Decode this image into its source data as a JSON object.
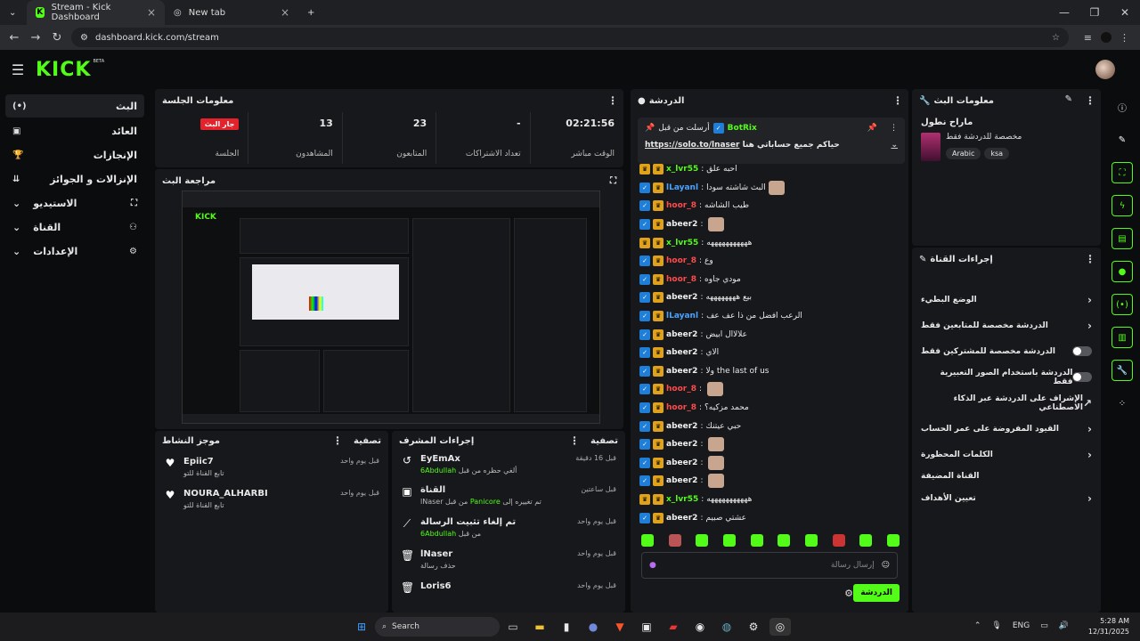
{
  "browser": {
    "tabs": [
      {
        "label": "Stream - Kick Dashboard"
      },
      {
        "label": "New tab"
      }
    ],
    "url": "dashboard.kick.com/stream"
  },
  "app": {
    "logo": "KICK",
    "beta": "BETA"
  },
  "sidebar": {
    "items": [
      {
        "label": "البث",
        "icon": "(•)"
      },
      {
        "label": "العائد",
        "icon": "▣"
      },
      {
        "label": "الإنجازات",
        "icon": "🏆"
      },
      {
        "label": "الإنزالات و الجوائز",
        "icon": "⇊"
      },
      {
        "label": "الاستيديو",
        "icon": "⛶"
      },
      {
        "label": "القناة",
        "icon": "⚇"
      },
      {
        "label": "الإعدادات",
        "icon": "⚙"
      }
    ]
  },
  "session": {
    "title": "معلومات الجلسة",
    "badge": "جار البث",
    "stats": [
      {
        "value": "02:21:56",
        "label": "الوقت مباشر"
      },
      {
        "value": "-",
        "label": "تعداد الاشتراكات"
      },
      {
        "value": "23",
        "label": "المتابعون"
      },
      {
        "value": "13",
        "label": "المشاهدون"
      },
      {
        "label": "الجلسة"
      }
    ]
  },
  "preview": {
    "title": "مراجعة البث"
  },
  "activity": {
    "title": "موجز النشاط",
    "filter": "تصفية",
    "items": [
      {
        "name": "Epiic7",
        "sub": "تابع القناة للتو",
        "time": "قبل يوم واحد"
      },
      {
        "name": "NOURA_ALHARBI",
        "sub": "تابع القناة للتو",
        "time": "قبل يوم واحد"
      }
    ]
  },
  "modactions": {
    "title": "إجراءات المشرف",
    "filter": "تصفية",
    "items": [
      {
        "name": "EyEmAx",
        "sub": "ألغي حظره من قبل",
        "actor": "6Abdullah",
        "time": "قبل 16 دقيقة",
        "icon": "↺"
      },
      {
        "name": "القناة",
        "sub": "تم تغييره إلى",
        "actor": "Panicore",
        "sub2": "من قبل",
        "actor2": "lNaser",
        "time": "قبل ساعتين",
        "icon": "▣"
      },
      {
        "name": "تم إلغاء تثبيت الرسالة",
        "sub": "من قبل",
        "actor": "6Abdullah",
        "time": "قبل يوم واحد",
        "icon": "⟋"
      },
      {
        "name": "lNaser",
        "sub": "حذف رسالة",
        "time": "قبل يوم واحد",
        "icon": "🗑"
      },
      {
        "name": "Loris6",
        "sub": "",
        "time": "قبل يوم واحد",
        "icon": "🗑"
      }
    ]
  },
  "chat": {
    "title": "الدردشة",
    "pinned": {
      "label": "أرسلت من قبل",
      "user": "BotRix",
      "text": "حياكم جميع حساباتي هنا",
      "link": "https://solo.to/lnaser"
    },
    "messages": [
      {
        "user": "x_lvr55",
        "color": "#53fc18",
        "badge": "b2",
        "text": "احبه علق"
      },
      {
        "user": "lLayanl",
        "color": "#4aa3ff",
        "badge": "b1",
        "text": "البث شاشته سودا",
        "emote": true
      },
      {
        "user": "hoor_8",
        "color": "#ff4a4a",
        "badge": "b1",
        "text": "طيب الشاشه"
      },
      {
        "user": "abeer2",
        "color": "#f0f0f0",
        "badge": "b1",
        "text": "",
        "emote": true
      },
      {
        "user": "x_lvr55",
        "color": "#53fc18",
        "badge": "b2",
        "text": "هههههههههههه"
      },
      {
        "user": "hoor_8",
        "color": "#ff4a4a",
        "badge": "b1",
        "text": "وع"
      },
      {
        "user": "hoor_8",
        "color": "#ff4a4a",
        "badge": "b1",
        "text": "مودي جاوه"
      },
      {
        "user": "abeer2",
        "color": "#f0f0f0",
        "badge": "b1",
        "text": "بيع ههههههههه"
      },
      {
        "user": "lLayanl",
        "color": "#4aa3ff",
        "badge": "b1",
        "text": "الرعب افضل من ذا عف عف"
      },
      {
        "user": "abeer2",
        "color": "#f0f0f0",
        "badge": "b1",
        "text": "علالاال ابيض"
      },
      {
        "user": "abeer2",
        "color": "#f0f0f0",
        "badge": "b1",
        "text": "الاي"
      },
      {
        "user": "abeer2",
        "color": "#f0f0f0",
        "badge": "b1",
        "text": "ولا the last of us"
      },
      {
        "user": "hoor_8",
        "color": "#ff4a4a",
        "badge": "b1",
        "text": "",
        "emote": true
      },
      {
        "user": "hoor_8",
        "color": "#ff4a4a",
        "badge": "b1",
        "text": "محمد مزكيه؟"
      },
      {
        "user": "abeer2",
        "color": "#f0f0f0",
        "badge": "b1",
        "text": "حبي عيتنك"
      },
      {
        "user": "abeer2",
        "color": "#f0f0f0",
        "badge": "b1",
        "text": "",
        "emote": true
      },
      {
        "user": "abeer2",
        "color": "#f0f0f0",
        "badge": "b1",
        "text": "",
        "emote": true
      },
      {
        "user": "abeer2",
        "color": "#f0f0f0",
        "badge": "b1",
        "text": "",
        "emote": true
      },
      {
        "user": "x_lvr55",
        "color": "#53fc18",
        "badge": "b2",
        "text": "هههههههههههه"
      },
      {
        "user": "abeer2",
        "color": "#f0f0f0",
        "badge": "b1",
        "text": "عشتي صبيم"
      }
    ],
    "placeholder": "إرسال رسالة",
    "send": "الدردشة"
  },
  "streaminfo": {
    "title": "معلومات البث",
    "stream_title": "ماراح نطول",
    "category": "مخصصة للدردشة فقط",
    "tags": [
      "Arabic",
      "ksa"
    ]
  },
  "channelactions": {
    "title": "إجراءات القناة",
    "rows": [
      {
        "label": "الوضع البطيء",
        "type": "chevron"
      },
      {
        "label": "الدردشة مخصصة للمتابعين فقط",
        "type": "chevron"
      },
      {
        "label": "الدردشة مخصصة للمشتركين فقط",
        "type": "toggle"
      },
      {
        "label": "الدردشة باستخدام الصور التعبيرية فقط",
        "type": "toggle"
      },
      {
        "label": "الإشراف على الدردشة عبر الذكاء الاصطناعي",
        "type": "link"
      },
      {
        "label": "القيود المفروضة على عمر الحساب",
        "type": "chevron"
      },
      {
        "label": "الكلمات المحظورة",
        "type": "chevron"
      },
      {
        "label": "القناة المضيفة",
        "type": "none"
      },
      {
        "label": "تعيين الأهداف",
        "type": "chevron"
      }
    ]
  },
  "taskbar": {
    "search": "Search",
    "lang": "ENG",
    "time": "5:28 AM",
    "date": "12/31/2025"
  }
}
